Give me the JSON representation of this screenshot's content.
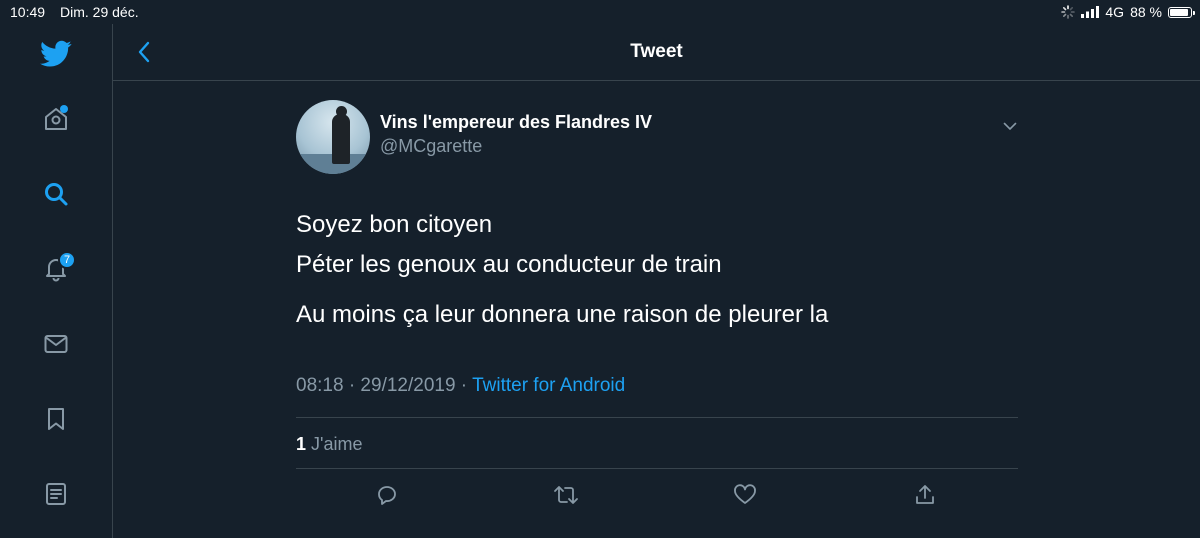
{
  "status_bar": {
    "time": "10:49",
    "date": "Dim. 29 déc.",
    "network": "4G",
    "battery": "88 %",
    "battery_level": 0.88
  },
  "sidebar": {
    "items": [
      {
        "name": "twitter-logo-icon"
      },
      {
        "name": "home-icon"
      },
      {
        "name": "search-icon"
      },
      {
        "name": "notifications-icon",
        "badge": "7"
      },
      {
        "name": "messages-icon"
      },
      {
        "name": "bookmarks-icon"
      },
      {
        "name": "lists-icon"
      }
    ]
  },
  "header": {
    "title": "Tweet"
  },
  "tweet": {
    "display_name": "Vins l'empereur des Flandres IV",
    "handle": "@MCgarette",
    "lines": [
      "Soyez bon citoyen",
      "Péter les genoux au conducteur de train",
      "Au moins ça leur donnera une raison de pleurer la"
    ],
    "timestamp": "08:18 · 29/12/2019 · ",
    "source": "Twitter for Android",
    "likes_count": "1",
    "likes_label": " J'aime"
  },
  "colors": {
    "background": "#15202b",
    "accent": "#1da1f2",
    "muted": "#8899a6",
    "border": "#38444d"
  }
}
